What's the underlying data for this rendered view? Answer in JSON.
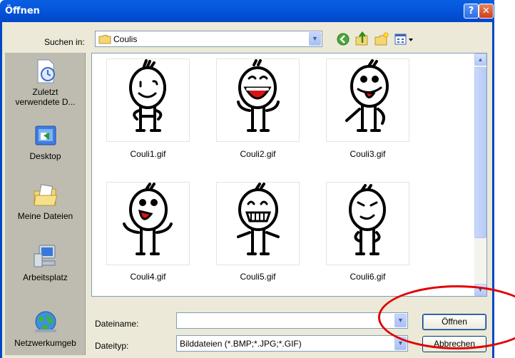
{
  "window": {
    "title": "Öffnen",
    "help": "?",
    "close": "✕"
  },
  "lookin": {
    "label": "Suchen in:",
    "value": "Coulis"
  },
  "toolbar": [
    "back-icon",
    "up-folder-icon",
    "new-folder-icon",
    "view-menu-icon"
  ],
  "places": [
    {
      "label": "Zuletzt verwendete D...",
      "icon": "recent-documents-icon"
    },
    {
      "label": "Desktop",
      "icon": "desktop-icon"
    },
    {
      "label": "Meine Dateien",
      "icon": "my-documents-icon"
    },
    {
      "label": "Arbeitsplatz",
      "icon": "my-computer-icon"
    },
    {
      "label": "Netzwerkumgeb",
      "icon": "network-places-icon"
    }
  ],
  "files": [
    {
      "name": "Couli1.gif",
      "face": "smile"
    },
    {
      "name": "Couli2.gif",
      "face": "laugh"
    },
    {
      "name": "Couli3.gif",
      "face": "tongue"
    },
    {
      "name": "Couli4.gif",
      "face": "cheer"
    },
    {
      "name": "Couli5.gif",
      "face": "teeth"
    },
    {
      "name": "Couli6.gif",
      "face": "smug"
    }
  ],
  "filename": {
    "label": "Dateiname:",
    "value": ""
  },
  "filetype": {
    "label": "Dateityp:",
    "value": "Bilddateien (*.BMP;*.JPG;*.GIF)"
  },
  "buttons": {
    "open": "Öffnen",
    "cancel": "Abbrechen"
  },
  "colors": {
    "titlebar": "#0555dd",
    "dialog_bg": "#ece9d8",
    "places_bg": "#bebcb0",
    "highlight": "#e00000"
  }
}
